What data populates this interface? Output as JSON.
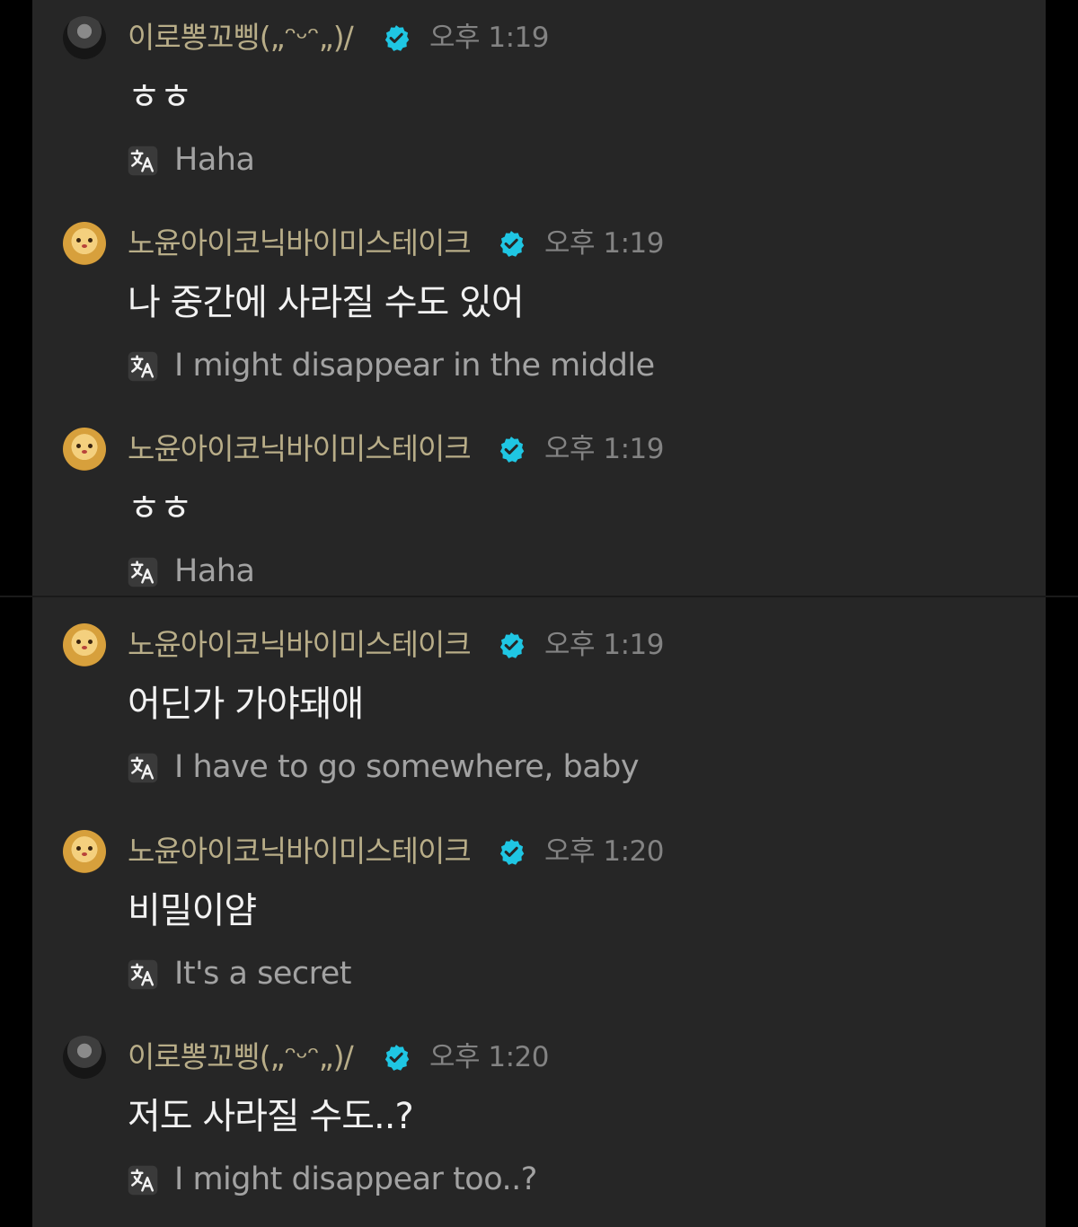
{
  "messages": [
    {
      "user": "이로뽕꼬삥(„ᵔᵕᵔ„)/",
      "time": "오후 1:19",
      "text": "ㅎㅎ",
      "translation": "Haha",
      "avatar": "dark"
    },
    {
      "user": "노윤아이코닉바이미스테이크",
      "time": "오후 1:19",
      "text": "나 중간에 사라질 수도 있어",
      "translation": "I might disappear in the middle",
      "avatar": "bear"
    },
    {
      "user": "노윤아이코닉바이미스테이크",
      "time": "오후 1:19",
      "text": "ㅎㅎ",
      "translation": "Haha",
      "avatar": "bear"
    },
    {
      "user": "노윤아이코닉바이미스테이크",
      "time": "오후 1:19",
      "text": "어딘가 가야돼애",
      "translation": "I have to go somewhere, baby",
      "avatar": "bear"
    },
    {
      "user": "노윤아이코닉바이미스테이크",
      "time": "오후 1:20",
      "text": "비밀이얌",
      "translation": "It's a secret",
      "avatar": "bear"
    },
    {
      "user": "이로뽕꼬삥(„ᵔᵕᵔ„)/",
      "time": "오후 1:20",
      "text": "저도 사라질 수도..?",
      "translation": "I might disappear too..?",
      "avatar": "dark"
    }
  ],
  "colors": {
    "background": "#262626",
    "username": "#b8ad88",
    "timestamp": "#838383",
    "message_text": "#f2f2f2",
    "translation_text": "#a2a2a2",
    "verified_badge": "#1fc6e3"
  },
  "icons": {
    "verified": "verified-badge-icon",
    "translate": "translate-icon"
  }
}
